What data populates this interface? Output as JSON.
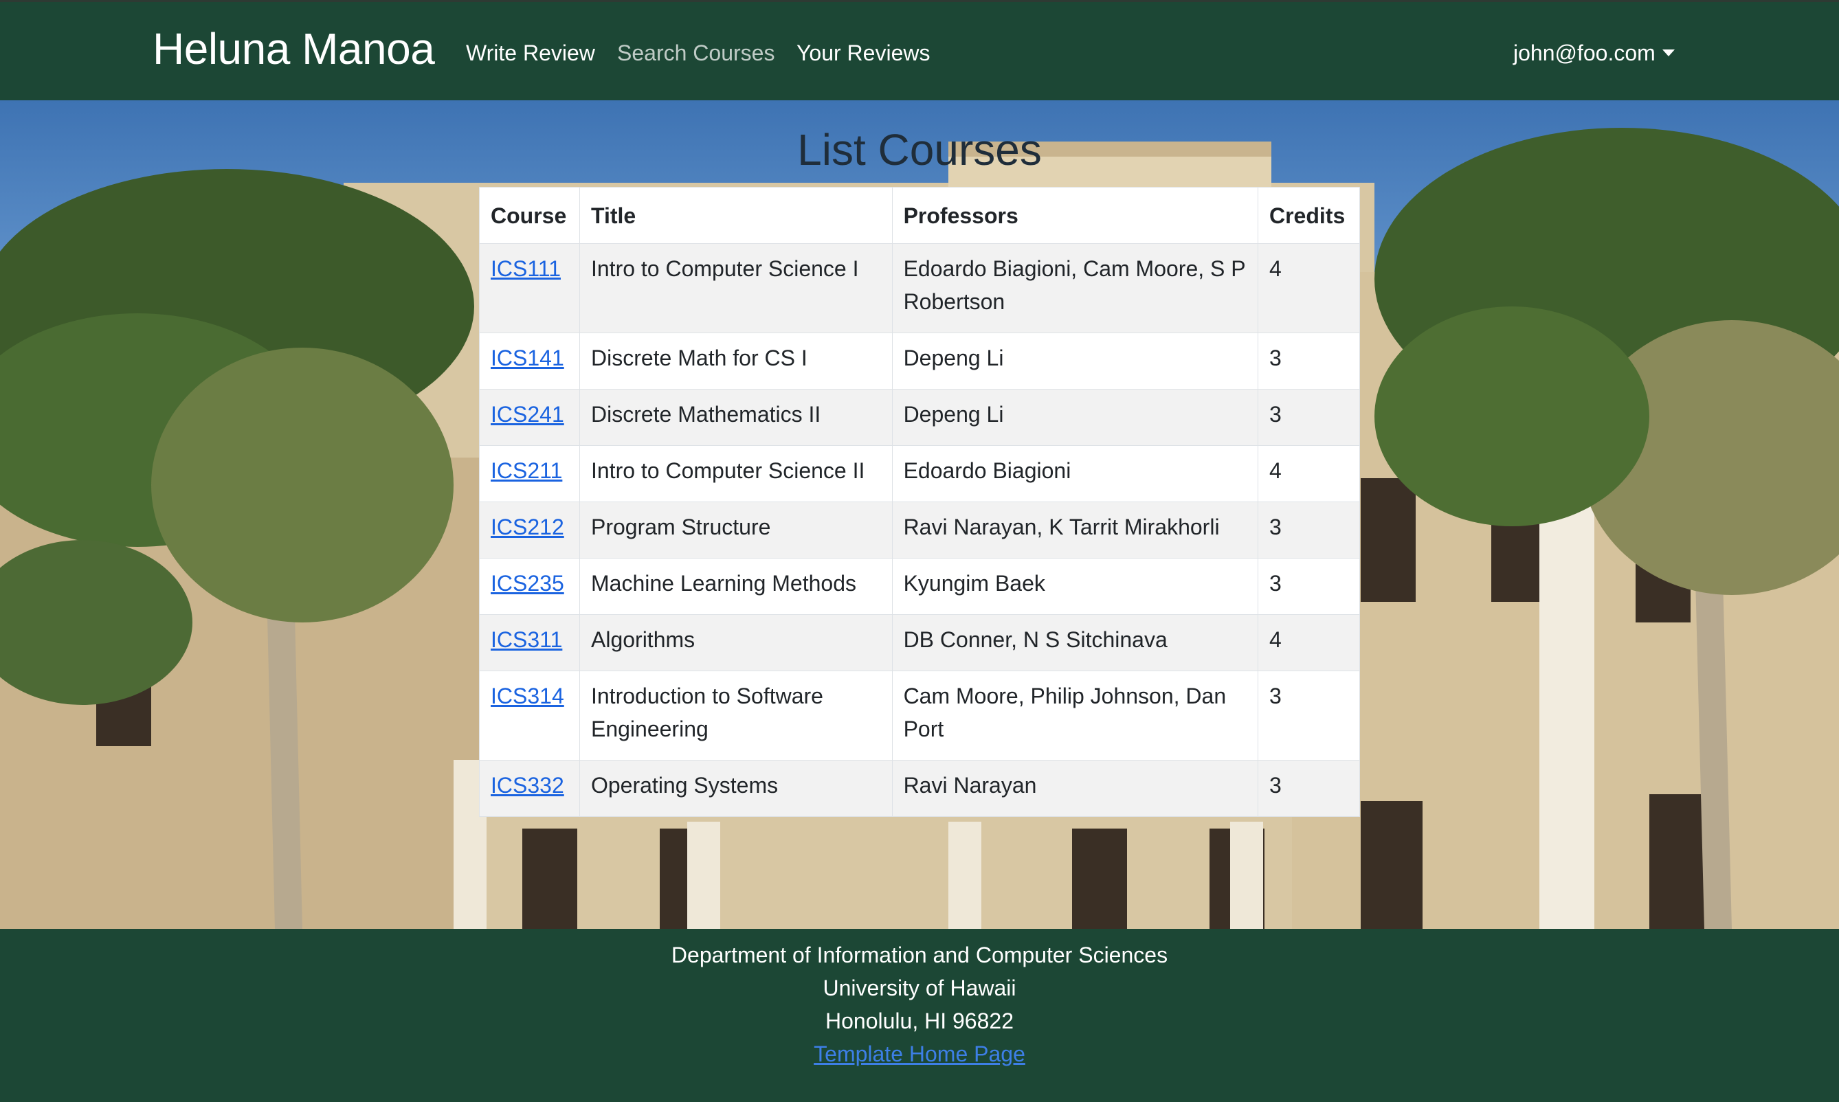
{
  "navbar": {
    "brand": "Heluna Manoa",
    "links": [
      "Write Review",
      "Search Courses",
      "Your Reviews"
    ],
    "user": "john@foo.com"
  },
  "page": {
    "title": "List Courses"
  },
  "table": {
    "headers": [
      "Course",
      "Title",
      "Professors",
      "Credits"
    ],
    "rows": [
      {
        "course": "ICS111",
        "title": "Intro to Computer Science I",
        "professors": "Edoardo Biagioni, Cam Moore, S P Robertson",
        "credits": "4"
      },
      {
        "course": "ICS141",
        "title": "Discrete Math for CS I",
        "professors": "Depeng Li",
        "credits": "3"
      },
      {
        "course": "ICS241",
        "title": "Discrete Mathematics II",
        "professors": "Depeng Li",
        "credits": "3"
      },
      {
        "course": "ICS211",
        "title": "Intro to Computer Science II",
        "professors": "Edoardo Biagioni",
        "credits": "4"
      },
      {
        "course": "ICS212",
        "title": "Program Structure",
        "professors": "Ravi Narayan, K Tarrit Mirakhorli",
        "credits": "3"
      },
      {
        "course": "ICS235",
        "title": "Machine Learning Methods",
        "professors": "Kyungim Baek",
        "credits": "3"
      },
      {
        "course": "ICS311",
        "title": "Algorithms",
        "professors": "DB Conner, N S Sitchinava",
        "credits": "4"
      },
      {
        "course": "ICS314",
        "title": "Introduction to Software Engineering",
        "professors": "Cam Moore, Philip Johnson, Dan Port",
        "credits": "3"
      },
      {
        "course": "ICS332",
        "title": "Operating Systems",
        "professors": "Ravi Narayan",
        "credits": "3"
      }
    ]
  },
  "footer": {
    "line1": "Department of Information and Computer Sciences",
    "line2": "University of Hawaii",
    "line3": "Honolulu, HI 96822",
    "link": "Template Home Page"
  },
  "colors": {
    "navbar_bg": "#1c4735",
    "link_blue": "#1a63e0",
    "stripe": "#f2f2f2"
  }
}
